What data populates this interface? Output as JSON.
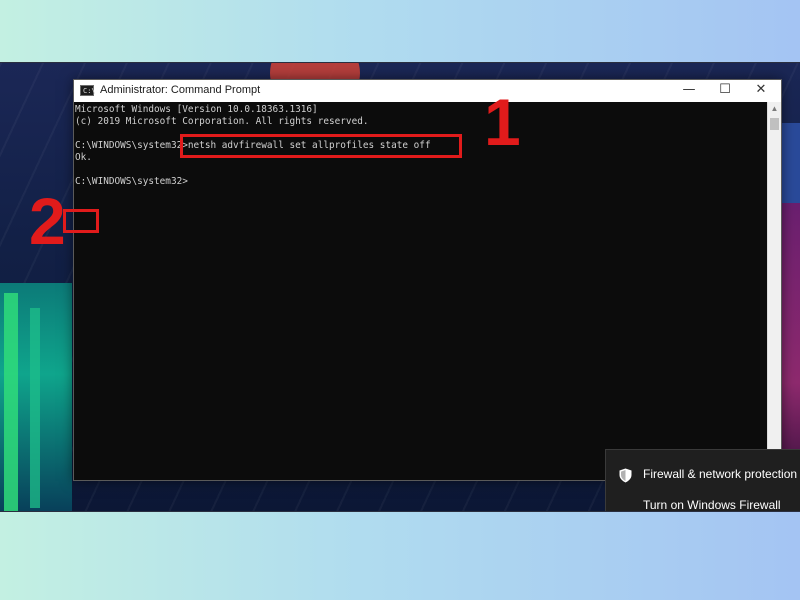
{
  "window": {
    "title": "Administrator: Command Prompt",
    "icon_label": "C:\\",
    "controls": {
      "minimize": "—",
      "maximize": "☐",
      "close": "✕"
    }
  },
  "console": {
    "lines": [
      "Microsoft Windows [Version 10.0.18363.1316]",
      "(c) 2019 Microsoft Corporation. All rights reserved.",
      "",
      "C:\\WINDOWS\\system32>netsh advfirewall set allprofiles state off",
      "Ok.",
      "",
      "C:\\WINDOWS\\system32>"
    ]
  },
  "annotations": {
    "step1": "1",
    "step2": "2",
    "color": "#e11b1b"
  },
  "notification": {
    "icon": "shield-icon",
    "title": "Firewall & network protection",
    "action": "Turn on Windows Firewall"
  }
}
